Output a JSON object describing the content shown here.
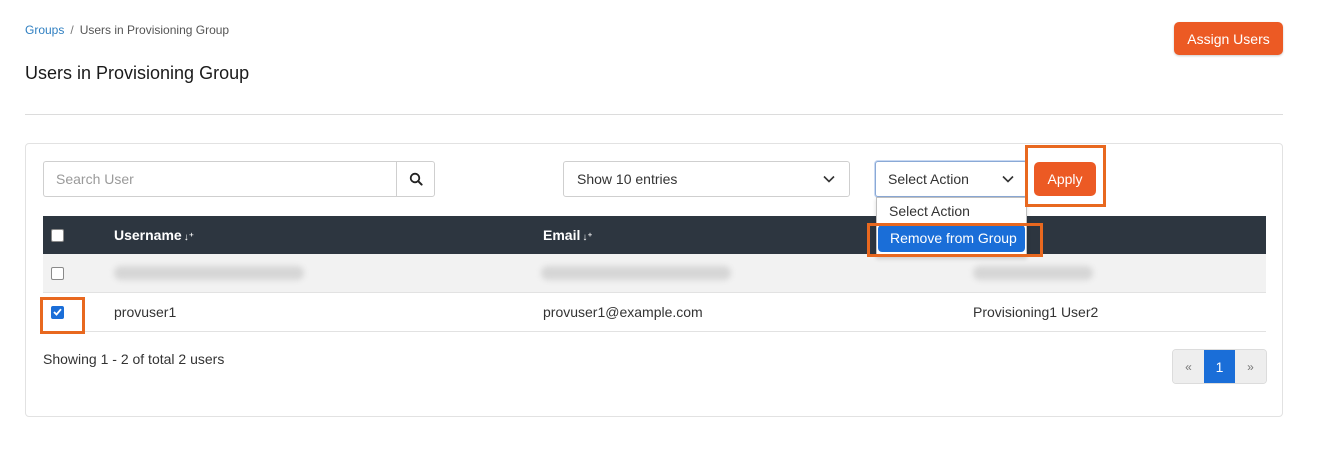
{
  "breadcrumb": {
    "link": "Groups",
    "separator": "/",
    "current": "Users in Provisioning Group"
  },
  "page_title": "Users in Provisioning Group",
  "assign_button": "Assign Users",
  "toolbar": {
    "search_placeholder": "Search User",
    "search_icon": "search-icon",
    "entries_value": "Show 10 entries",
    "action_value": "Select Action",
    "apply_label": "Apply",
    "dropdown_options": [
      "Select Action",
      "Remove from Group"
    ]
  },
  "table": {
    "headers": {
      "username": "Username",
      "email": "Email"
    },
    "rows": [
      {
        "username": "provuser1",
        "email": "provuser1@example.com",
        "name": "Provisioning1 User2",
        "checked": true
      }
    ]
  },
  "footer": {
    "showing": "Showing 1 - 2 of total 2 users"
  },
  "pagination": {
    "prev": "«",
    "current": "1",
    "next": "»"
  },
  "colors": {
    "accent": "#ec5a24",
    "primary": "#1a6ed8",
    "header_bg": "#2d3640",
    "highlight": "#e8681f"
  }
}
